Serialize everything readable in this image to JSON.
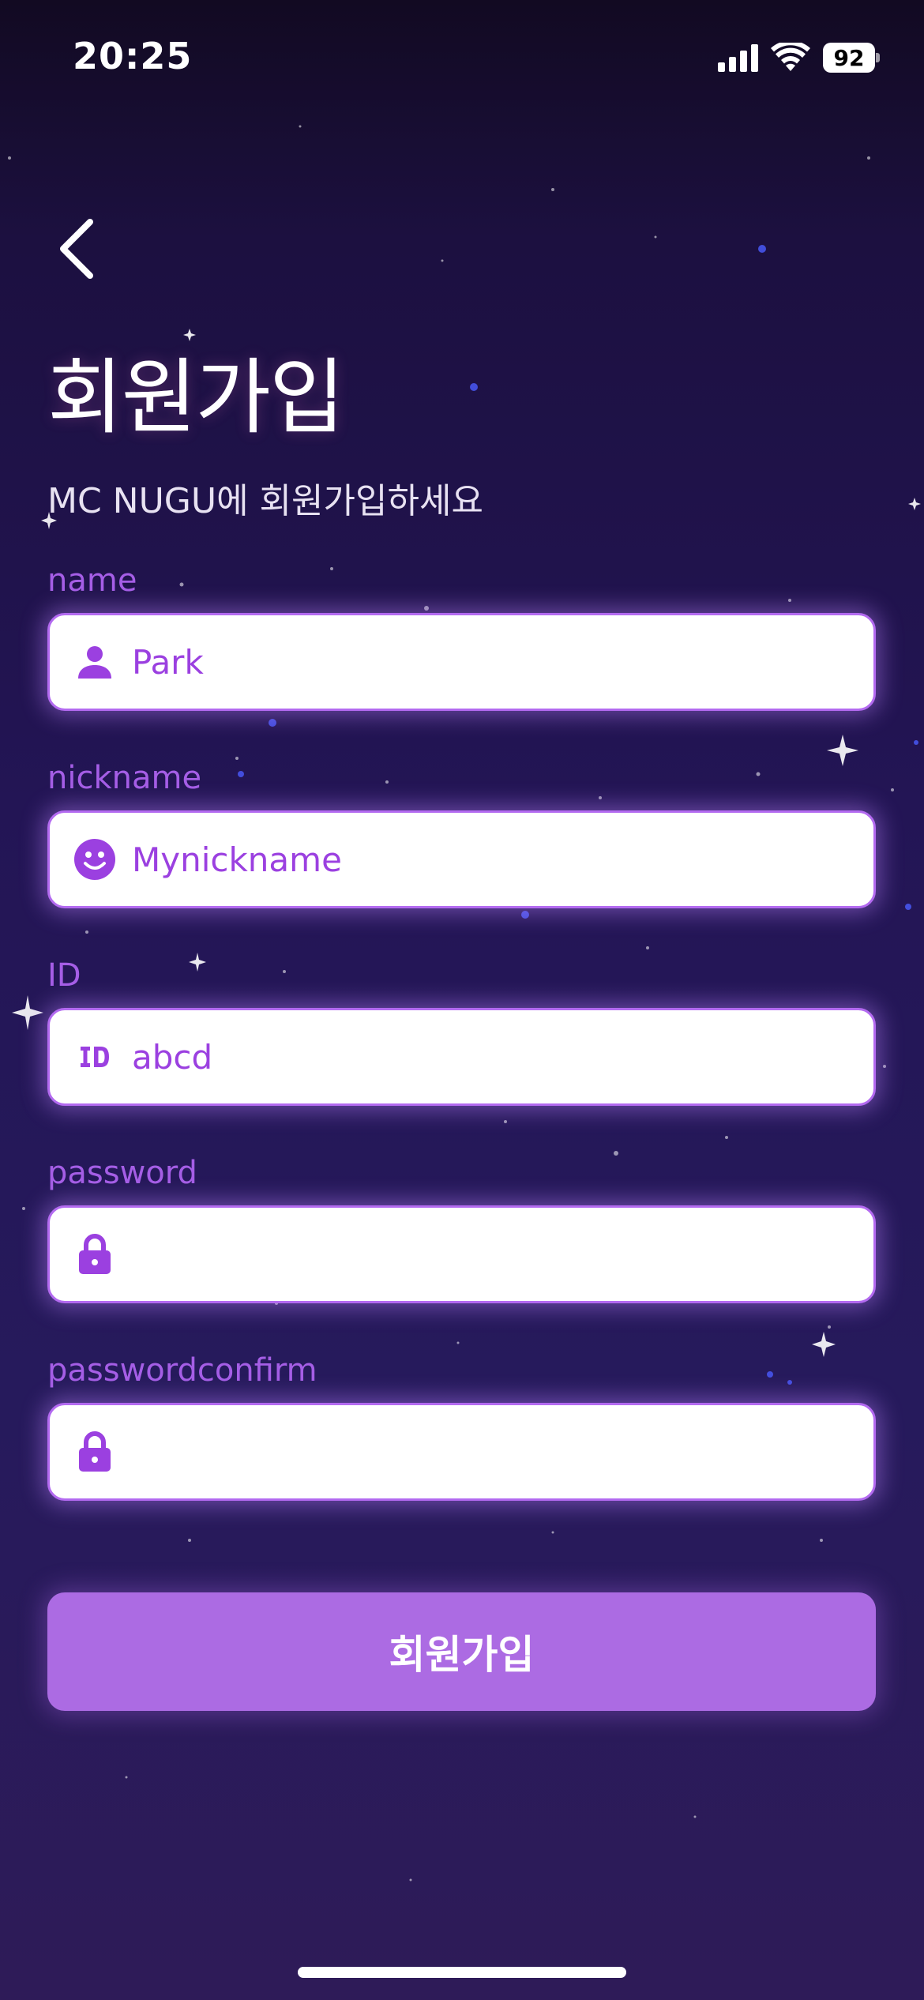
{
  "status_bar": {
    "time": "20:25",
    "battery": "92"
  },
  "header": {
    "title": "회원가입",
    "subtitle": "MC NUGU에 회원가입하세요"
  },
  "form": {
    "fields": [
      {
        "label": "name",
        "value": "Park",
        "icon": "person-icon"
      },
      {
        "label": "nickname",
        "value": "Mynickname",
        "icon": "smiley-icon"
      },
      {
        "label": "ID",
        "value": "abcd",
        "icon": "id-icon"
      },
      {
        "label": "password",
        "value": "",
        "icon": "lock-icon"
      },
      {
        "label": "passwordconfirm",
        "value": "",
        "icon": "lock-icon"
      }
    ],
    "submit_label": "회원가입"
  },
  "colors": {
    "accent": "#a55ee6",
    "button": "#ac6be3",
    "field_border": "#b36af0"
  }
}
